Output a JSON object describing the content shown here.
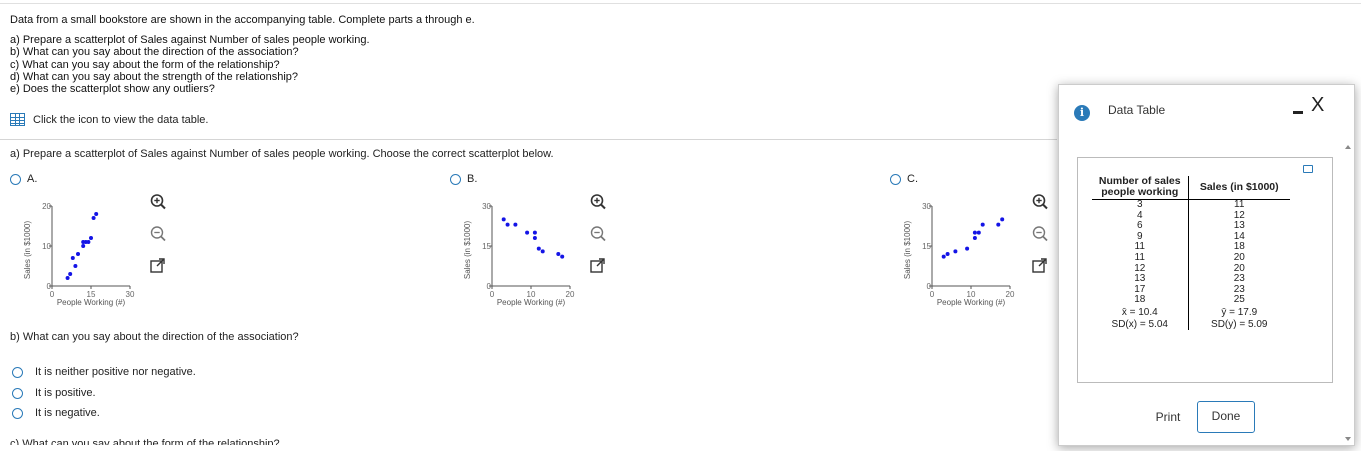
{
  "intro": {
    "lead": "Data from a small bookstore are shown in the accompanying table. Complete parts a through e.",
    "parts": [
      "a) Prepare a scatterplot of Sales against Number of sales people working.",
      "b) What can you say about the direction of the association?",
      "c) What can you say about the form of the relationship?",
      "d) What can you say about the strength of the relationship?",
      "e) Does the scatterplot show any outliers?"
    ],
    "data_link": "Click the icon to view the data table."
  },
  "partA": {
    "prompt": "a) Prepare a scatterplot of Sales against Number of sales people working. Choose the correct scatterplot below.",
    "options": [
      "A.",
      "B.",
      "C."
    ]
  },
  "partB": {
    "prompt": "b) What can you say about the direction of the association?",
    "choices": [
      "It is neither positive nor negative.",
      "It is positive.",
      "It is negative."
    ]
  },
  "partC": {
    "prompt": "c) What can you say about the form of the relationship?"
  },
  "modal": {
    "title": "Data Table",
    "info_glyph": "i",
    "close_glyph": "X",
    "headers": [
      "Number of sales people working",
      "Sales (in $1000)"
    ],
    "rows": [
      [
        "3",
        "11"
      ],
      [
        "4",
        "12"
      ],
      [
        "6",
        "13"
      ],
      [
        "9",
        "14"
      ],
      [
        "11",
        "18"
      ],
      [
        "11",
        "20"
      ],
      [
        "12",
        "20"
      ],
      [
        "13",
        "23"
      ],
      [
        "17",
        "23"
      ],
      [
        "18",
        "25"
      ]
    ],
    "stats": [
      [
        "x̄ = 10.4",
        "ȳ = 17.9"
      ],
      [
        "SD(x) = 5.04",
        "SD(y) = 5.09"
      ]
    ],
    "print_label": "Print",
    "done_label": "Done"
  },
  "chart_data": [
    {
      "type": "scatter",
      "title": "A",
      "xlabel": "People Working (#)",
      "ylabel": "Sales (in $1000)",
      "xlim": [
        0,
        30
      ],
      "ylim": [
        0,
        20
      ],
      "xticks": [
        "0",
        "15",
        "30"
      ],
      "yticks": [
        "0",
        "10",
        "20"
      ],
      "color": "#1414e6",
      "x": [
        6,
        7,
        9,
        8,
        10,
        12,
        12,
        13,
        14,
        15,
        16,
        17
      ],
      "y": [
        2,
        3,
        5,
        7,
        8,
        10,
        11,
        11,
        11,
        12,
        17,
        18
      ]
    },
    {
      "type": "scatter",
      "title": "B",
      "xlabel": "People Working (#)",
      "ylabel": "Sales (in $1000)",
      "xlim": [
        0,
        20
      ],
      "ylim": [
        0,
        30
      ],
      "xticks": [
        "0",
        "10",
        "20"
      ],
      "yticks": [
        "0",
        "15",
        "30"
      ],
      "color": "#1414e6",
      "x": [
        3,
        4,
        6,
        9,
        11,
        11,
        12,
        13,
        17,
        18
      ],
      "y": [
        25,
        23,
        23,
        20,
        20,
        18,
        14,
        13,
        12,
        11
      ]
    },
    {
      "type": "scatter",
      "title": "C",
      "xlabel": "People Working (#)",
      "ylabel": "Sales (in $1000)",
      "xlim": [
        0,
        20
      ],
      "ylim": [
        0,
        30
      ],
      "xticks": [
        "0",
        "10",
        "20"
      ],
      "yticks": [
        "0",
        "15",
        "30"
      ],
      "color": "#1414e6",
      "x": [
        3,
        4,
        6,
        9,
        11,
        11,
        12,
        13,
        17,
        18
      ],
      "y": [
        11,
        12,
        13,
        14,
        18,
        20,
        20,
        23,
        23,
        25
      ]
    }
  ]
}
